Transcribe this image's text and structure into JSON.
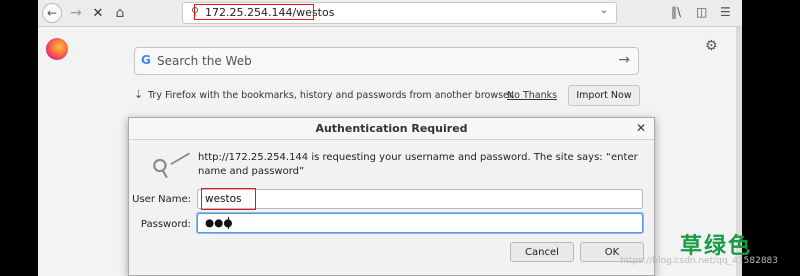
{
  "toolbar": {
    "url": "172.25.254.144/westos"
  },
  "newtab": {
    "search_placeholder": "Search the Web",
    "search_engine_letter": "G",
    "import_text": "Try Firefox with the bookmarks, history and passwords from another browser.",
    "no_thanks": "No Thanks",
    "import_now": "Import Now"
  },
  "dialog": {
    "title": "Authentication Required",
    "message": "http://172.25.254.144 is requesting your username and password. The site says: “enter name and password”",
    "username_label": "User Name:",
    "username_value": "westos",
    "password_label": "Password:",
    "password_value": "●●●",
    "cancel": "Cancel",
    "ok": "OK"
  },
  "watermark": {
    "logo_text": "草绿色",
    "credit": "https://blog.csdn.net/qq_41582883"
  },
  "colors": {
    "highlight": "#ee1111",
    "watermark_green": "#1a9b46",
    "focus_ring": "#5a9ae6"
  }
}
